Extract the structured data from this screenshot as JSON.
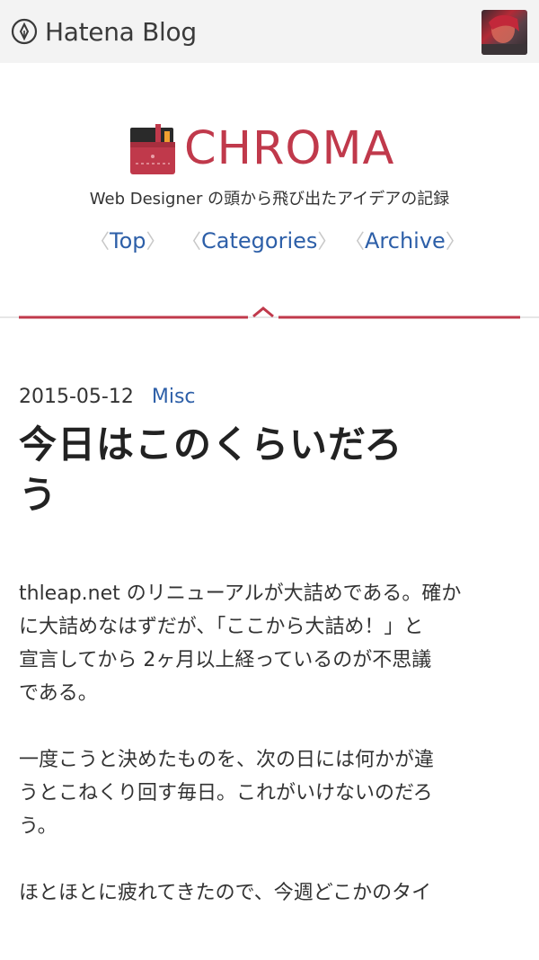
{
  "topbar": {
    "brand_label": "Hatena Blog",
    "brand_icon": "hatena-pen-icon",
    "avatar_alt": "user-avatar"
  },
  "site": {
    "title": "CHROMA",
    "tagline": "Web Designer の頭から飛び出たアイデアの記録",
    "accent_color": "#c0394b",
    "link_color": "#2d5fa8"
  },
  "nav": {
    "items": [
      {
        "label": "Top"
      },
      {
        "label": "Categories"
      },
      {
        "label": "Archive"
      }
    ]
  },
  "post": {
    "date": "2015-05-12",
    "category": "Misc",
    "title_lines": [
      "今日はこのくらいだろ",
      "う"
    ],
    "paragraphs": [
      [
        "thleap.net のリニューアルが大詰めである。確か",
        "に大詰めなはずだが、「ここから大詰め！」と",
        "宣言してから 2ヶ月以上経っているのが不思議",
        "である。"
      ],
      [
        "一度こうと決めたものを、次の日には何かが違",
        "うとこねくり回す毎日。これがいけないのだろ",
        "う。"
      ],
      [
        "ほとほとに疲れてきたので、今週どこかのタイ"
      ]
    ]
  }
}
